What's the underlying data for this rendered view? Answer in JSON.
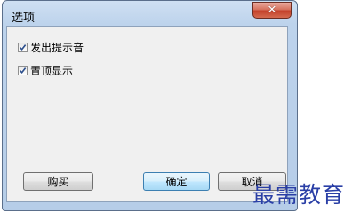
{
  "dialog": {
    "title": "选项",
    "close_glyph": "✕"
  },
  "options": [
    {
      "label": "发出提示音",
      "checked": true
    },
    {
      "label": "置顶显示",
      "checked": true
    }
  ],
  "buttons": {
    "buy": "购买",
    "ok": "确定",
    "cancel": "取消"
  },
  "watermark": "最需教育",
  "colors": {
    "titlebar": "#bdd3ec",
    "client": "#f0f0f0",
    "close_button": "#c4412a",
    "watermark": "#2a3fa6"
  }
}
